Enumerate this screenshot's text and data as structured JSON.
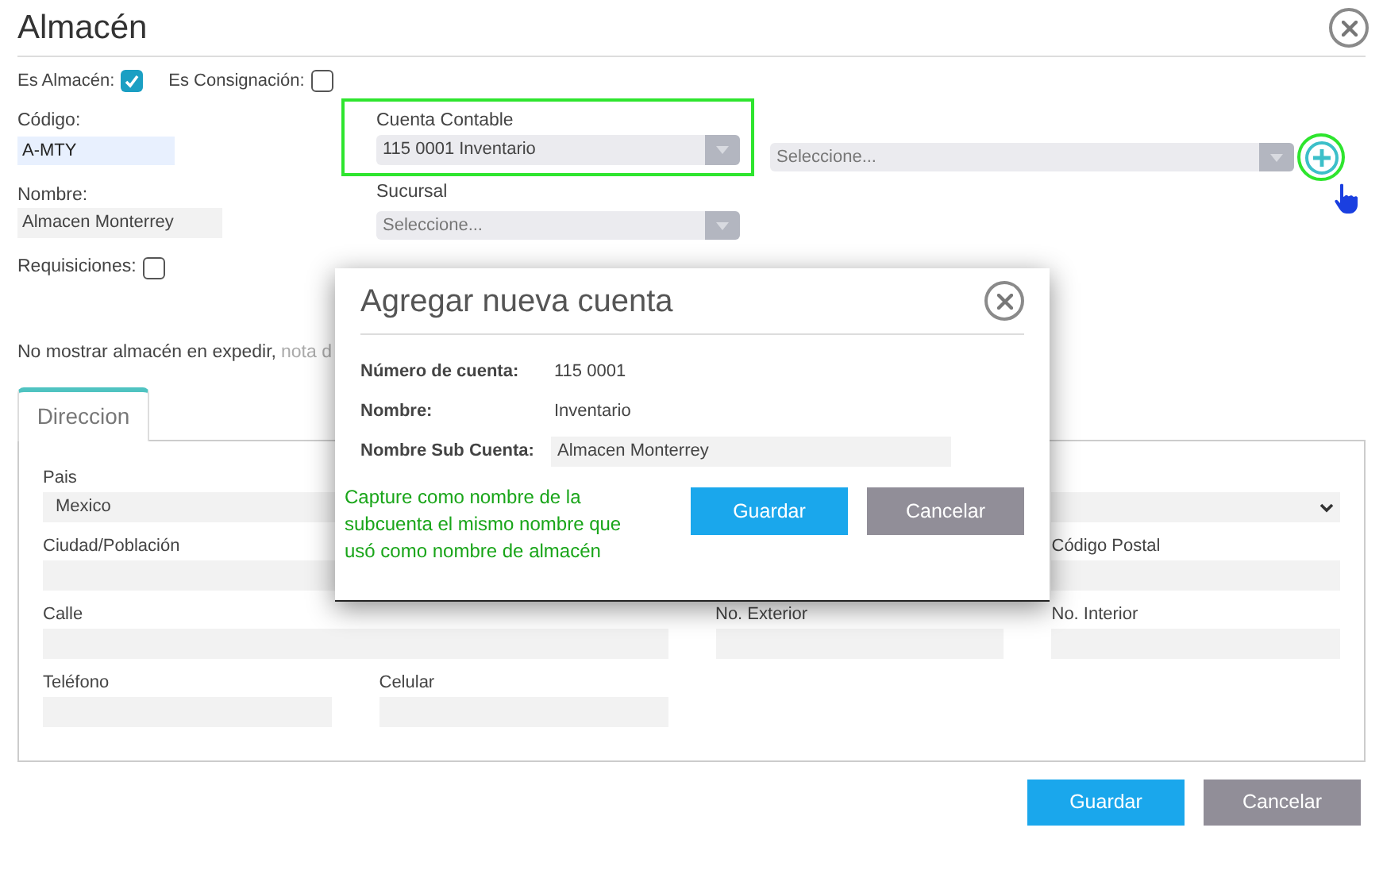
{
  "title": "Almacén",
  "checks": [
    {
      "label": "Es Almacén:",
      "checked": true
    },
    {
      "label": "Es Consignación:",
      "checked": false
    }
  ],
  "codigo": {
    "label": "Código:",
    "value": "A-MTY"
  },
  "nombre": {
    "label": "Nombre:",
    "value": "Almacen Monterrey"
  },
  "requisiciones": {
    "label": "Requisiciones:",
    "checked": false
  },
  "cuenta_contable": {
    "label": "Cuenta Contable",
    "value": "115 0001 Inventario",
    "highlighted": true
  },
  "sucursal": {
    "label": "Sucursal",
    "placeholder": "Seleccione..."
  },
  "subcuenta_select": {
    "placeholder": "Seleccione..."
  },
  "add_button": {
    "highlighted": true
  },
  "note": {
    "text": "No mostrar almacén en expedir,",
    "faded_text": "nota d"
  },
  "tabs": [
    {
      "label": "Direccion",
      "selected": true
    }
  ],
  "address_rows": [
    [
      {
        "kind": "text",
        "label": "Pais",
        "value": "Mexico",
        "wide": true
      },
      {
        "kind": "select",
        "wide": false
      }
    ],
    [
      {
        "kind": "text",
        "label": "Ciudad/Población",
        "wide": true
      },
      {
        "kind": "text",
        "label": "Código Postal",
        "wide": false
      }
    ],
    [
      {
        "kind": "text",
        "label": "Calle",
        "wide": true
      },
      {
        "kind": "text",
        "label": "No. Exterior",
        "wide": false
      },
      {
        "kind": "text",
        "label": "No. Interior",
        "wide": false
      }
    ],
    [
      {
        "kind": "text",
        "label": "Teléfono",
        "wide": false
      },
      {
        "kind": "text",
        "label": "Celular",
        "wide": false
      }
    ]
  ],
  "buttons": [
    "Guardar",
    "Cancelar"
  ],
  "dialog": {
    "title": "Agregar nueva cuenta",
    "rows": [
      {
        "kind": "text",
        "label": "Número de cuenta:",
        "value": "115 0001"
      },
      {
        "kind": "text",
        "label": "Nombre:",
        "value": "Inventario"
      },
      {
        "kind": "input",
        "label": "Nombre Sub Cuenta:",
        "value": "Almacen Monterrey"
      }
    ],
    "hint": "Capture como nombre de la subcuenta el mismo nombre que usó como nombre de almacén",
    "buttons": [
      "Guardar",
      "Cancelar"
    ]
  }
}
